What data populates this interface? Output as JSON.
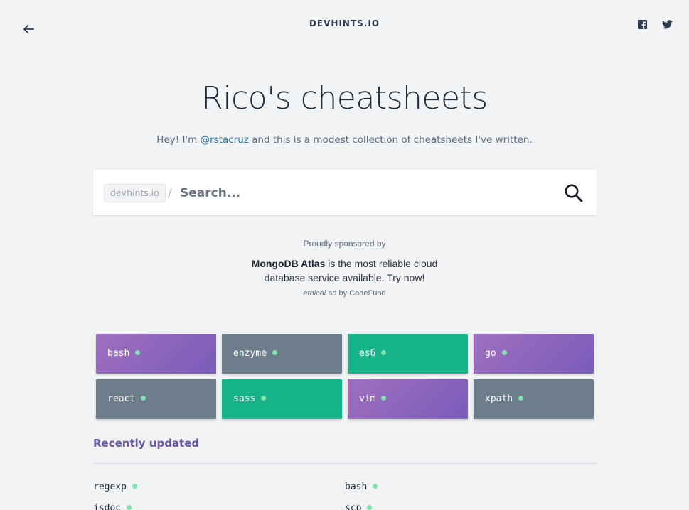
{
  "header": {
    "brand": "DEVHINTS.IO",
    "back_icon": "back-arrow-icon",
    "social": [
      "facebook-icon",
      "twitter-icon"
    ]
  },
  "hero": {
    "title": "Rico's cheatsheets",
    "subtitle_before": "Hey! I'm ",
    "subtitle_link": "@rstacruz",
    "subtitle_after": " and this is a modest collection of cheatsheets I've written."
  },
  "search": {
    "prefix": "devhints.io",
    "slash": "/",
    "placeholder": "Search...",
    "value": ""
  },
  "sponsor": {
    "heading": "Proudly sponsored by",
    "brand": "MongoDB Atlas",
    "body": " is the most reliable cloud database service available. Try now!",
    "foot_italic": "ethical",
    "foot_rest": " ad by CodeFund"
  },
  "tiles": [
    {
      "label": "bash",
      "color": "purple"
    },
    {
      "label": "enzyme",
      "color": "slate"
    },
    {
      "label": "es6",
      "color": "teal"
    },
    {
      "label": "go",
      "color": "purple"
    },
    {
      "label": "react",
      "color": "slate"
    },
    {
      "label": "sass",
      "color": "teal"
    },
    {
      "label": "vim",
      "color": "purple"
    },
    {
      "label": "xpath",
      "color": "slate"
    }
  ],
  "recent": {
    "heading": "Recently updated",
    "items": [
      "regexp",
      "bash",
      "jsdoc",
      "scp"
    ]
  },
  "colors": {
    "background": "#f2f3f5",
    "accent_purple": "#7a5cba",
    "accent_teal": "#17b38a",
    "slate": "#6e7d8c",
    "link": "#2b6f9e",
    "dot_green": "#7fe3b3"
  }
}
